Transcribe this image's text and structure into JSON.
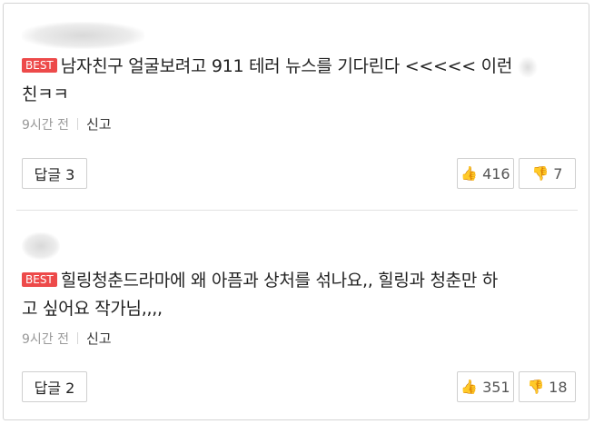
{
  "comments": [
    {
      "badge": "BEST",
      "text_line1": "남자친구 얼굴보려고 911 테러 뉴스를 기다린다 <<<<< 이런",
      "text_line2": "친ㅋㅋ",
      "time": "9시간 전",
      "report_label": "신고",
      "reply_label": "답글 3",
      "likes": "416",
      "dislikes": "7"
    },
    {
      "badge": "BEST",
      "text_line1": "힐링청춘드라마에 왜 아픔과 상처를 섞나요,, 힐링과 청춘만 하",
      "text_line2": "고 싶어요 작가님,,,,",
      "time": "9시간 전",
      "report_label": "신고",
      "reply_label": "답글 2",
      "likes": "351",
      "dislikes": "18"
    }
  ],
  "colors": {
    "badge": "#ed4a4a",
    "thumb": "#e2a583"
  },
  "icons": {
    "like": "thumbs-up-icon",
    "dislike": "thumbs-down-icon"
  }
}
